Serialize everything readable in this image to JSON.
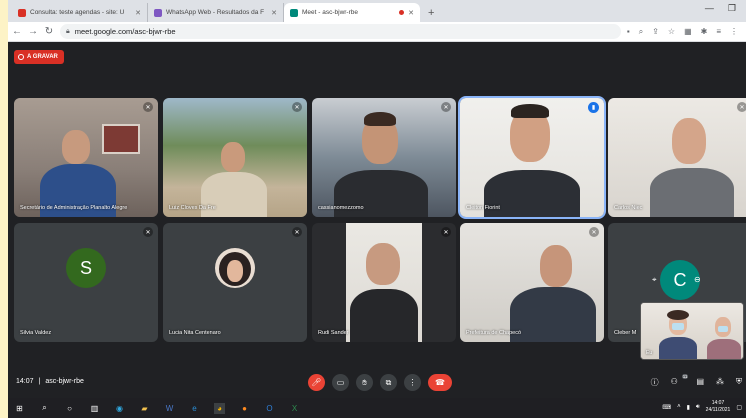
{
  "browser": {
    "tabs": [
      {
        "title": "Consulta: teste agendas - site: U",
        "fav_color": "#d93025",
        "active": false
      },
      {
        "title": "WhatsApp Web - Resultados da F",
        "fav_color": "#7e57c2",
        "active": false
      },
      {
        "title": "Meet - asc-bjwr-rbe",
        "fav_color": "#00897b",
        "active": true
      }
    ],
    "new_tab": "+",
    "address": "meet.google.com/asc-bjwr-rbe"
  },
  "meet": {
    "recording_label": "A GRAVAR",
    "participants": [
      {
        "name": "Secretário de Administração Planalto Alegre",
        "muted": true
      },
      {
        "name": "Luiz Cloves Da Fre",
        "muted": true
      },
      {
        "name": "cassianomezzomo",
        "muted": true
      },
      {
        "name": "Cleiton Fiorint",
        "speaking": true
      },
      {
        "name": "Carlos Niec",
        "muted": true
      },
      {
        "name": "Silvia Valdez",
        "initial": "S",
        "avatar_color": "#33691e",
        "muted": true
      },
      {
        "name": "Lucia Nita Centenaro",
        "muted": true
      },
      {
        "name": "Rudi Sander",
        "muted": true
      },
      {
        "name": "Prefeitura de Chapecó",
        "muted": true
      },
      {
        "name": "Cleber M",
        "initial": "C",
        "avatar_color": "#00897b"
      }
    ],
    "self_label": "Eu",
    "time": "14:07",
    "meeting_code": "asc-bjwr-rbe",
    "people_count": "11"
  },
  "taskbar": {
    "time": "14:07",
    "date": "24/11/2021"
  }
}
